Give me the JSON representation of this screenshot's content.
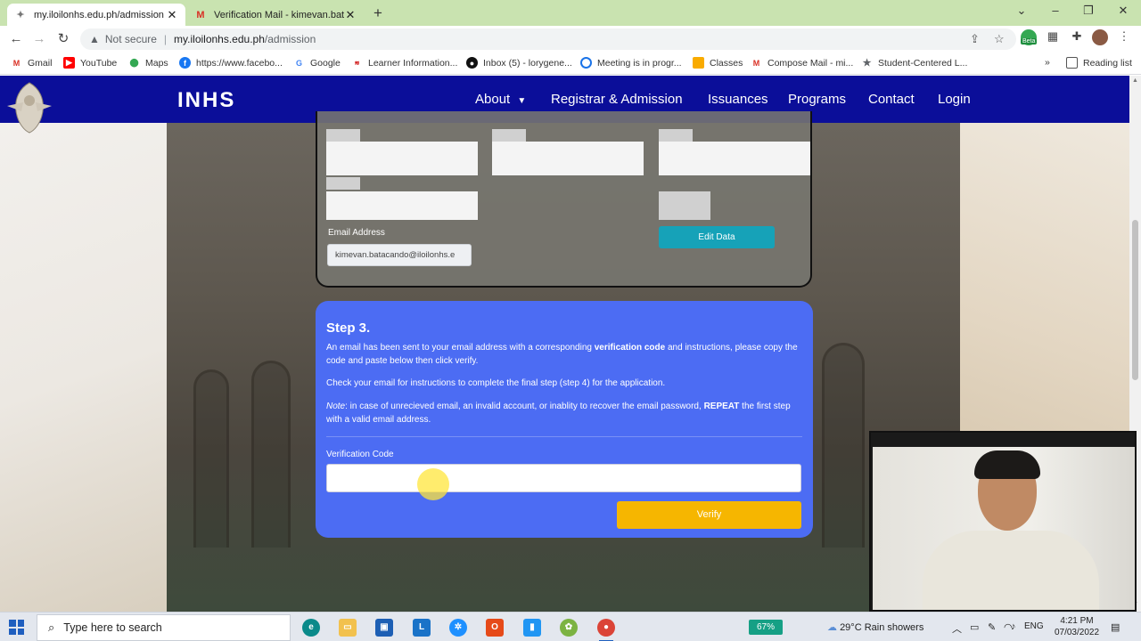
{
  "browser": {
    "tabs": [
      {
        "title": "my.iloilonhs.edu.ph/admission",
        "active": true
      },
      {
        "title": "Verification Mail - kimevan.batac",
        "active": false
      }
    ],
    "new_tab": "+",
    "window_controls": {
      "chevron": "⌄",
      "minimize": "–",
      "maximize": "❐",
      "close": "✕"
    },
    "address": {
      "security": "Not secure",
      "host": "my.iloilonhs.edu.ph",
      "path": "/admission"
    },
    "bookmarks": [
      {
        "label": "Gmail"
      },
      {
        "label": "YouTube"
      },
      {
        "label": "Maps"
      },
      {
        "label": "https://www.facebo..."
      },
      {
        "label": "Google"
      },
      {
        "label": "Learner Information..."
      },
      {
        "label": "Inbox (5) - lorygene..."
      },
      {
        "label": "Meeting is in progr..."
      },
      {
        "label": "Classes"
      },
      {
        "label": "Compose Mail - mi..."
      },
      {
        "label": "Student-Centered L..."
      }
    ],
    "more_bookmarks": "»",
    "reading_list": "Reading list",
    "profile_badge": "Beta"
  },
  "site": {
    "brand": "INHS",
    "nav": {
      "about": "About",
      "registrar": "Registrar & Admission",
      "issuances": "Issuances",
      "programs": "Programs",
      "contact": "Contact",
      "login": "Login"
    }
  },
  "info_card": {
    "email_label": "Email Address",
    "email_value": "kimevan.batacando@iloilonhs.e",
    "edit_button": "Edit Data"
  },
  "step_card": {
    "title": "Step 3.",
    "p1_a": "An email has been sent to your email address with a corresponding ",
    "p1_b": "verification code",
    "p1_c": " and instructions, please copy the code and paste below then click verify.",
    "p2": "Check your email for instructions to complete the final step (step 4) for the application.",
    "p3_note": "Note",
    "p3_a": ": in case of unrecieved email, an invalid account, or inablity to recover the email password, ",
    "p3_b": "REPEAT",
    "p3_c": " the first step with a valid email address.",
    "code_label": "Verification Code",
    "code_value": "",
    "verify_button": "Verify"
  },
  "taskbar": {
    "search_placeholder": "Type here to search",
    "battery": "67%",
    "weather": "29°C  Rain showers",
    "language": "ENG",
    "time": "4:21 PM",
    "date": "07/03/2022"
  }
}
